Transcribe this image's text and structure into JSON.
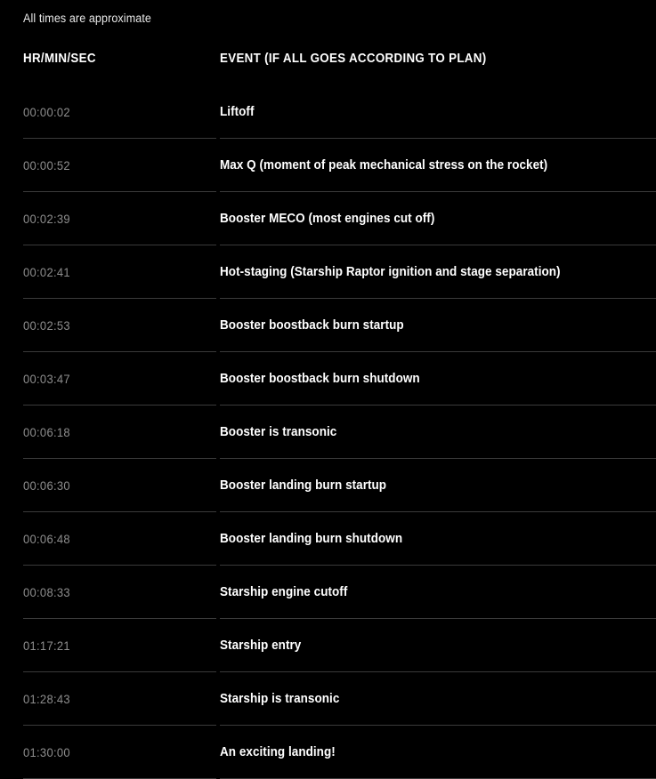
{
  "caption": "All times are approximate",
  "table": {
    "columns": [
      {
        "key": "time",
        "label": "HR/MIN/SEC"
      },
      {
        "key": "event",
        "label": "EVENT (IF ALL GOES ACCORDING TO PLAN)"
      }
    ],
    "rows": [
      {
        "time": "00:00:02",
        "event": "Liftoff"
      },
      {
        "time": "00:00:52",
        "event": "Max Q (moment of peak mechanical stress on the rocket)"
      },
      {
        "time": "00:02:39",
        "event": "Booster MECO (most engines cut off)"
      },
      {
        "time": "00:02:41",
        "event": "Hot-staging (Starship Raptor ignition and stage separation)"
      },
      {
        "time": "00:02:53",
        "event": "Booster boostback burn startup"
      },
      {
        "time": "00:03:47",
        "event": "Booster boostback burn shutdown"
      },
      {
        "time": "00:06:18",
        "event": "Booster is transonic"
      },
      {
        "time": "00:06:30",
        "event": "Booster landing burn startup"
      },
      {
        "time": "00:06:48",
        "event": "Booster landing burn shutdown"
      },
      {
        "time": "00:08:33",
        "event": "Starship engine cutoff"
      },
      {
        "time": "01:17:21",
        "event": "Starship entry"
      },
      {
        "time": "01:28:43",
        "event": "Starship is transonic"
      },
      {
        "time": "01:30:00",
        "event": "An exciting landing!"
      }
    ]
  },
  "colors": {
    "background": "#000000",
    "text_primary": "#ffffff",
    "text_muted": "#8d8d8d",
    "caption": "#e8e8e8",
    "separator": "#3b3b3b"
  }
}
